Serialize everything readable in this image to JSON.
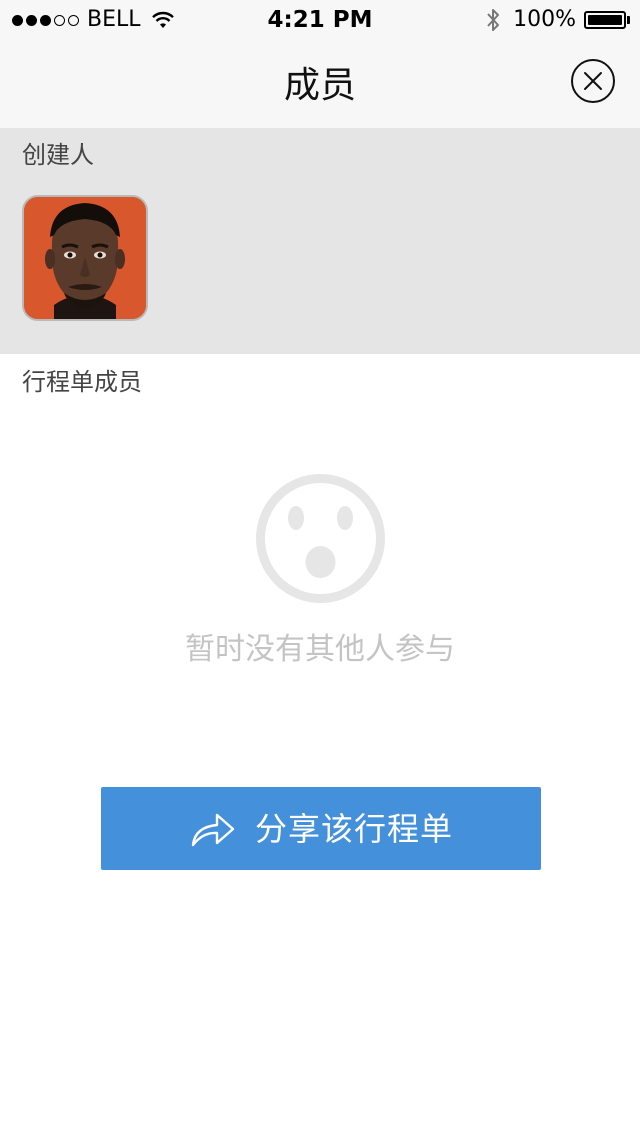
{
  "status_bar": {
    "carrier": "BELL",
    "signal_bars_filled": 3,
    "signal_bars_total": 5,
    "time": "4:21 PM",
    "battery": "100%",
    "battery_level": 1.0
  },
  "nav": {
    "title": "成员",
    "close_icon": "close-circle-icon"
  },
  "creator_section": {
    "label": "创建人",
    "avatar_background": "#d8572c"
  },
  "members_section": {
    "label": "行程单成员",
    "empty_icon": "surprised-face-icon",
    "empty_text": "暂时没有其他人参与"
  },
  "share_button": {
    "label": "分享该行程单",
    "icon": "share-arrow-icon",
    "color": "#4590db"
  }
}
